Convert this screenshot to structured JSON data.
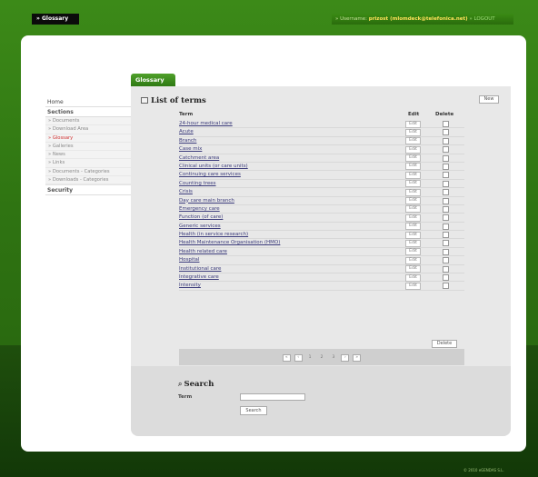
{
  "header": {
    "section_label": "» Glossary",
    "username_label": "» Username:",
    "username_value": "prizost (mlomdeck@telefonica.net)",
    "logout_label": "» LOGOUT"
  },
  "sidebar": {
    "home": "Home",
    "sections": "Sections",
    "items": [
      {
        "label": "» Documents"
      },
      {
        "label": "» Download Area"
      },
      {
        "label": "» Glossary"
      },
      {
        "label": "» Galleries"
      },
      {
        "label": "» News"
      },
      {
        "label": "» Links"
      },
      {
        "label": "» Documents - Categories"
      },
      {
        "label": "» Downloads - Categories"
      }
    ],
    "security": "Security"
  },
  "main": {
    "tab_label": "Glossary",
    "list_title": "List of terms",
    "new_label": "New",
    "columns": {
      "term": "Term",
      "edit": "Edit",
      "delete": "Delete"
    },
    "edit_label": "Edit",
    "terms": [
      "24-hour medical care",
      "Acute",
      "Branch",
      "Case mix",
      "Catchment area",
      "Clinical units (or care units)",
      "Continuing care services",
      "Counting trees",
      "Crisis",
      "Day care main branch",
      "Emergency care",
      "Function (of care)",
      "Generic services",
      "Health (in service research)",
      "Health Maintenance Organisation (HMO)",
      "Health related care",
      "Hospital",
      "Institutional care",
      "Integrative care",
      "Intensity"
    ],
    "delete_label": "Delete",
    "pager": {
      "first": "«",
      "prev": "‹",
      "pages": [
        "1",
        "2",
        "3"
      ],
      "next": "›",
      "last": "»"
    }
  },
  "search": {
    "title": "Search",
    "term_label": "Term",
    "term_value": "",
    "button_label": "Search"
  },
  "footer": {
    "text": "© 2010 eGENDAS S.L."
  }
}
